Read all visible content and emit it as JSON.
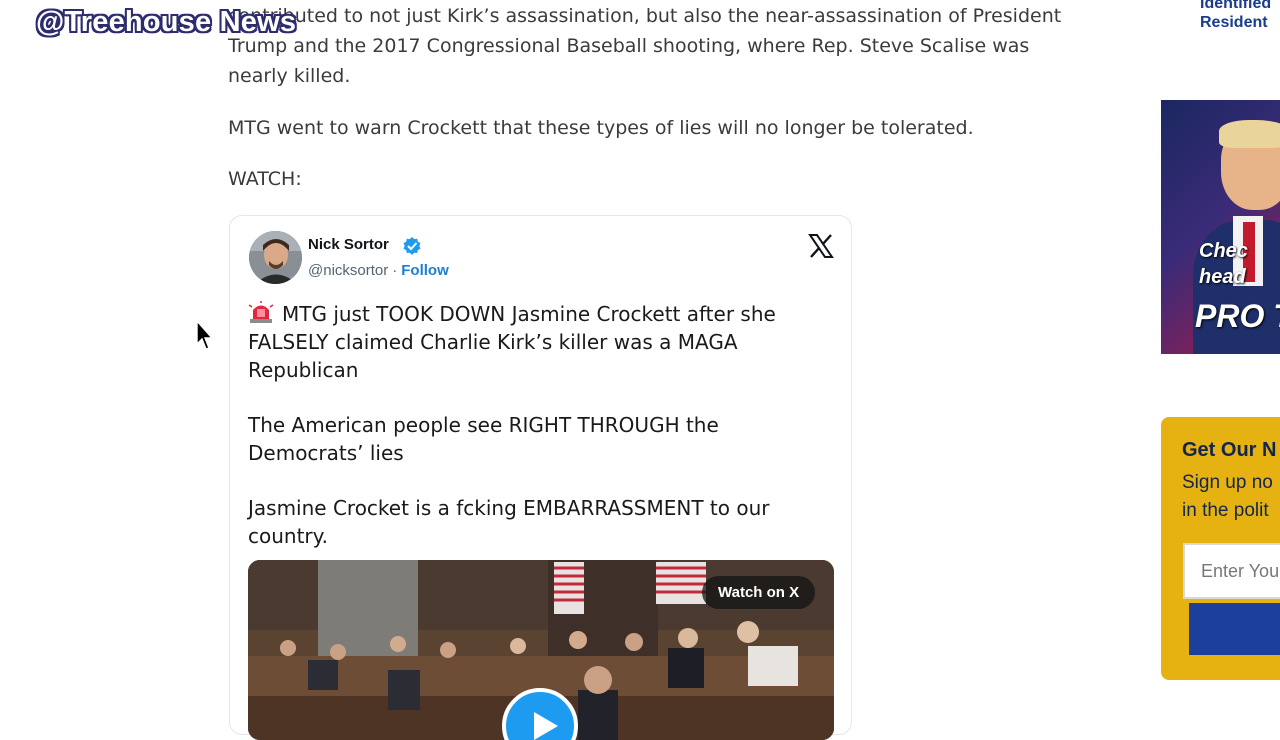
{
  "watermark": "@Treehouse News",
  "article": {
    "paragraph1": "contributed to not just Kirk’s assassination, but also the near-assassination of President Trump and the 2017 Congressional Baseball shooting, where Rep. Steve Scalise was nearly killed.",
    "paragraph2": "MTG went to warn Crockett that these types of lies will no longer be tolerated.",
    "paragraph3": "WATCH:"
  },
  "tweet": {
    "author_name": "Nick Sortor",
    "handle": "@nicksortor",
    "separator": "·",
    "follow_label": "Follow",
    "text": {
      "line1": "MTG just TOOK DOWN Jasmine Crockett after she FALSELY claimed Charlie Kirk’s killer was a MAGA Republican",
      "line2": "The American people see RIGHT THROUGH the Democrats’ lies",
      "line3": "Jasmine Crocket is a fcking EMBARRASSMENT to our country."
    },
    "watch_label": "Watch on X",
    "icons": {
      "siren": "siren-emoji-icon",
      "verified": "verified-badge-icon",
      "x_logo": "x-logo-icon",
      "play": "play-icon"
    }
  },
  "sidebar": {
    "related_link": "Identified Resident",
    "ad": {
      "line1": "Chec",
      "line2": "head",
      "line3": "PRO T"
    },
    "newsletter": {
      "title": "Get Our N",
      "desc_line1": "Sign up no",
      "desc_line2": "in the polit",
      "email_placeholder": "Enter You"
    }
  },
  "colors": {
    "newsletter_bg": "#e5b211",
    "follow_link": "#1d7fd1",
    "play_button": "#1d9bf0",
    "sidebar_link": "#1a3d8f"
  }
}
